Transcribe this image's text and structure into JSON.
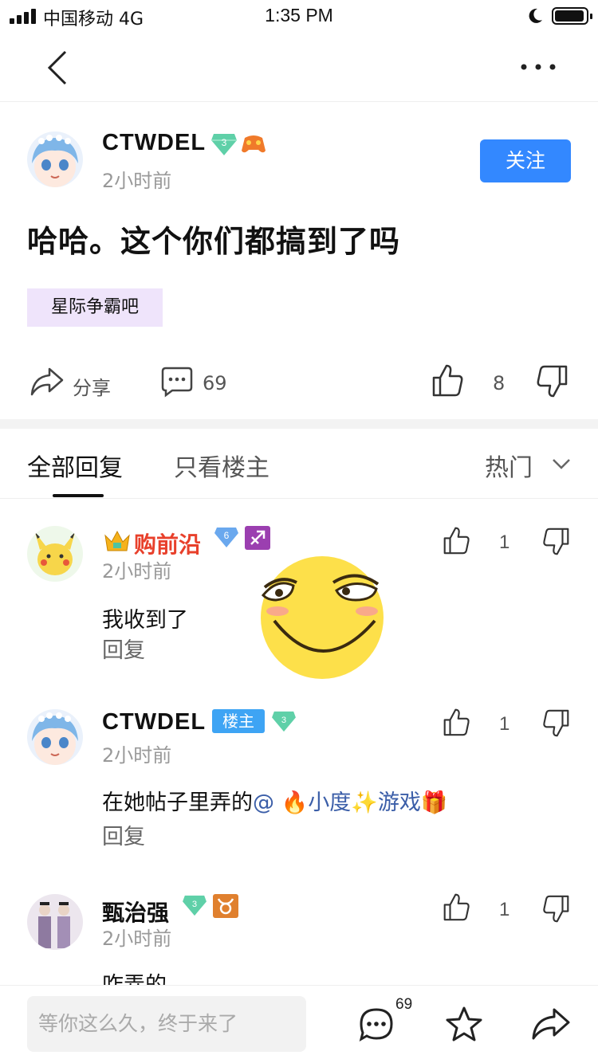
{
  "status_bar": {
    "carrier": "中国移动 4G",
    "time": "1:35 PM"
  },
  "post": {
    "author": "CTWDEL",
    "level": "3",
    "time": "2小时前",
    "follow_label": "关注",
    "title": "哈哈。这个你们都搞到了吗",
    "tag": "星际争霸吧",
    "share_label": "分享",
    "comment_count": "69",
    "like_count": "8"
  },
  "tabs": {
    "all": "全部回复",
    "op_only": "只看楼主",
    "sort": "热门"
  },
  "comments": [
    {
      "name": "购前沿",
      "level": "6",
      "time": "2小时前",
      "text": "我收到了",
      "reply": "回复",
      "likes": "1"
    },
    {
      "name": "CTWDEL",
      "badge": "楼主",
      "level": "3",
      "time": "2小时前",
      "text_prefix": "在她帖子里弄的",
      "mention": "@ 🔥小度✨游戏🎁",
      "reply": "回复",
      "likes": "1"
    },
    {
      "name": "甄治强",
      "level": "3",
      "time": "2小时前",
      "text": "咋弄的",
      "likes": "1"
    }
  ],
  "bottom_bar": {
    "placeholder": "等你这么久，终于来了",
    "comment_count": "69"
  },
  "colors": {
    "accent": "#3388ff",
    "tag_bg": "#efe4fb",
    "username_red": "#e8402b",
    "mention_blue": "#3b5ea8",
    "host_badge": "#3ea4f4",
    "level_gem": "#5fd0a8"
  }
}
